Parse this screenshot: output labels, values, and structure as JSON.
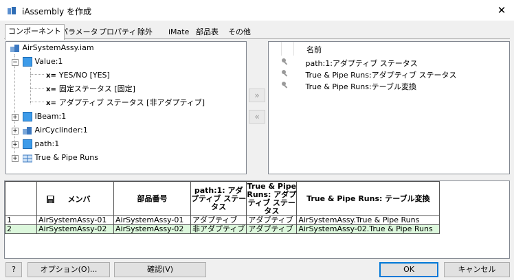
{
  "window": {
    "title": "iAssembly を作成",
    "close_glyph": "✕"
  },
  "tabs": [
    "コンポーネント",
    "パラメータ",
    "プロパティ",
    "除外",
    "iMate",
    "部品表",
    "その他"
  ],
  "tree": {
    "root": "AirSystemAssy.iam",
    "value_node": "Value:1",
    "value_children": [
      "YES/NO [YES]",
      "固定ステータス [固定]",
      "アダプティブ ステータス [非アダプティブ]"
    ],
    "x_prefix": "x=",
    "others": [
      "IBeam:1",
      "AirCyclinder:1",
      "path:1",
      "True & Pipe Runs"
    ]
  },
  "move_buttons": {
    "add": "»",
    "remove": "«"
  },
  "right_list": {
    "header": "名前",
    "items": [
      "path:1:アダプティブ ステータス",
      "True & Pipe Runs:アダプティブ ステータス",
      "True & Pipe Runs:テーブル変換"
    ]
  },
  "grid": {
    "headers": {
      "member": "メンバ",
      "part_number": "部品番号",
      "path_adaptive": "path:1: アダプティブ ステータス",
      "tp_adaptive": "True & Pipe Runs: アダプティブ ステータス",
      "tp_table": "True & Pipe Runs: テーブル変換"
    },
    "rows": [
      {
        "num": "1",
        "member": "AirSystemAssy-01",
        "part": "AirSystemAssy-01",
        "path": "アダプティブ",
        "tp": "アダプティブ",
        "table": "AirSystemAssy.True & Pipe Runs"
      },
      {
        "num": "2",
        "member": "AirSystemAssy-02",
        "part": "AirSystemAssy-02",
        "path": "非アダプティブ",
        "tp": "アダプティブ",
        "table": "AirSystemAssy-02.True & Pipe Runs"
      }
    ]
  },
  "footer": {
    "help": "?",
    "options": "オプション(O)...",
    "verify": "確認(V)",
    "ok": "OK",
    "cancel": "キャンセル"
  }
}
